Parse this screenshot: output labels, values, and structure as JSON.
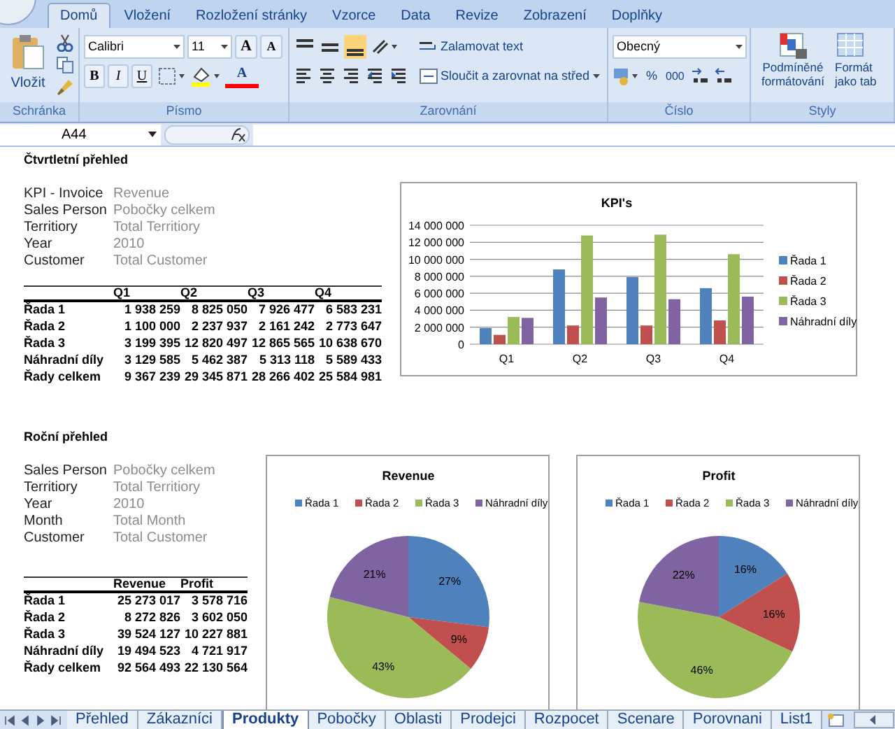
{
  "ribbon_tabs": [
    {
      "label": "Domů",
      "selected": true
    },
    {
      "label": "Vložení",
      "selected": false
    },
    {
      "label": "Rozložení stránky",
      "selected": false
    },
    {
      "label": "Vzorce",
      "selected": false
    },
    {
      "label": "Data",
      "selected": false
    },
    {
      "label": "Revize",
      "selected": false
    },
    {
      "label": "Zobrazení",
      "selected": false
    },
    {
      "label": "Doplňky",
      "selected": false
    }
  ],
  "ribbon": {
    "clipboard": {
      "paste": "Vložit",
      "group": "Schránka"
    },
    "font": {
      "name": "Calibri",
      "size": "11",
      "grow": "A",
      "shrink": "A",
      "bold": "B",
      "italic": "I",
      "underline": "U",
      "font_color_key": "A",
      "group": "Písmo"
    },
    "alignment": {
      "wrap": "Zalamovat text",
      "merge": "Sloučit a zarovnat na střed",
      "group": "Zarovnání"
    },
    "number": {
      "format": "Obecný",
      "percent": "%",
      "thousands": "000",
      "group": "Číslo"
    },
    "styles": {
      "conditional": [
        "Podmíněné",
        "formátování"
      ],
      "format_table": [
        "Formát",
        "jako tab"
      ],
      "group": "Styly"
    }
  },
  "name_box": "A44",
  "quarterly": {
    "title": "Čtvrtletní přehled",
    "filters": [
      {
        "label": "KPI - Invoice",
        "value": "Revenue"
      },
      {
        "label": "Sales Person",
        "value": "Pobočky celkem"
      },
      {
        "label": "Territiory",
        "value": "Total Territiory"
      },
      {
        "label": "Year",
        "value": "2010"
      },
      {
        "label": "Customer",
        "value": "Total Customer"
      }
    ],
    "table": {
      "columns": [
        "Q1",
        "Q2",
        "Q3",
        "Q4"
      ],
      "rows": [
        {
          "label": "Řada 1",
          "cells": [
            "1 938 259",
            "8 825 050",
            "7 926 477",
            "6 583 231"
          ]
        },
        {
          "label": "Řada 2",
          "cells": [
            "1 100 000",
            "2 237 937",
            "2 161 242",
            "2 773 647"
          ]
        },
        {
          "label": "Řada 3",
          "cells": [
            "3 199 395",
            "12 820 497",
            "12 865 565",
            "10 638 670"
          ]
        },
        {
          "label": "Náhradní díly",
          "cells": [
            "3 129 585",
            "5 462 387",
            "5 313 118",
            "5 589 433"
          ]
        },
        {
          "label": "Řady celkem",
          "cells": [
            "9 367 239",
            "29 345 871",
            "28 266 402",
            "25 584 981"
          ]
        }
      ]
    },
    "chart_data": {
      "type": "bar",
      "title": "KPI's",
      "categories": [
        "Q1",
        "Q2",
        "Q3",
        "Q4"
      ],
      "series": [
        {
          "name": "Řada 1",
          "color": "#4f81bd",
          "values": [
            1900000,
            8800000,
            7900000,
            6600000
          ]
        },
        {
          "name": "Řada 2",
          "color": "#c0504d",
          "values": [
            1100000,
            2200000,
            2200000,
            2800000
          ]
        },
        {
          "name": "Řada 3",
          "color": "#9bbb59",
          "values": [
            3200000,
            12800000,
            12900000,
            10600000
          ]
        },
        {
          "name": "Náhradní díly",
          "color": "#8064a2",
          "values": [
            3100000,
            5500000,
            5300000,
            5600000
          ]
        }
      ],
      "ylim": [
        0,
        14000000
      ],
      "grid": true,
      "legend": "right",
      "yticks": [
        {
          "value": 0,
          "label": "0"
        },
        {
          "value": 2000000,
          "label": "2 000 000"
        },
        {
          "value": 4000000,
          "label": "4 000 000"
        },
        {
          "value": 6000000,
          "label": "6 000 000"
        },
        {
          "value": 8000000,
          "label": "8 000 000"
        },
        {
          "value": 10000000,
          "label": "10 000 000"
        },
        {
          "value": 12000000,
          "label": "12 000 000"
        },
        {
          "value": 14000000,
          "label": "14 000 000"
        }
      ]
    }
  },
  "annual": {
    "title": "Roční přehled",
    "filters": [
      {
        "label": "Sales Person",
        "value": "Pobočky celkem"
      },
      {
        "label": "Territiory",
        "value": "Total Territiory"
      },
      {
        "label": "Year",
        "value": "2010"
      },
      {
        "label": "Month",
        "value": "Total Month"
      },
      {
        "label": "Customer",
        "value": "Total Customer"
      }
    ],
    "table": {
      "columns": [
        "Revenue",
        "Profit"
      ],
      "rows": [
        {
          "label": "Řada 1",
          "cells": [
            "25 273 017",
            "3 578 716"
          ]
        },
        {
          "label": "Řada 2",
          "cells": [
            "8 272 826",
            "3 602 050"
          ]
        },
        {
          "label": "Řada 3",
          "cells": [
            "39 524 127",
            "10 227 881"
          ]
        },
        {
          "label": "Náhradní díly",
          "cells": [
            "19 494 523",
            "4 721 917"
          ]
        },
        {
          "label": "Řady celkem",
          "cells": [
            "92 564 493",
            "22 130 564"
          ]
        }
      ]
    },
    "charts": [
      {
        "chart_data": {
          "type": "pie",
          "title": "Revenue",
          "categories": [
            "Řada 1",
            "Řada 2",
            "Řada 3",
            "Náhradní díly"
          ],
          "values": [
            27,
            9,
            43,
            21
          ],
          "legend": "top",
          "colors": [
            "#4f81bd",
            "#c0504d",
            "#9bbb59",
            "#8064a2"
          ],
          "value_labels": [
            "27%",
            "9%",
            "43%",
            "21%"
          ]
        }
      },
      {
        "chart_data": {
          "type": "pie",
          "title": "Profit",
          "categories": [
            "Řada 1",
            "Řada 2",
            "Řada 3",
            "Náhradní díly"
          ],
          "values": [
            16,
            16,
            46,
            22
          ],
          "legend": "top",
          "colors": [
            "#4f81bd",
            "#c0504d",
            "#9bbb59",
            "#8064a2"
          ],
          "value_labels": [
            "16%",
            "16%",
            "46%",
            "22%"
          ]
        }
      }
    ]
  },
  "sheet_tabs": [
    {
      "label": "Přehled",
      "selected": false
    },
    {
      "label": "Zákazníci",
      "selected": false
    },
    {
      "label": "Produkty",
      "selected": true
    },
    {
      "label": "Pobočky",
      "selected": false
    },
    {
      "label": "Oblasti",
      "selected": false
    },
    {
      "label": "Prodejci",
      "selected": false
    },
    {
      "label": "Rozpocet",
      "selected": false
    },
    {
      "label": "Scenare",
      "selected": false
    },
    {
      "label": "Porovnani",
      "selected": false
    },
    {
      "label": "List1",
      "selected": false
    }
  ]
}
